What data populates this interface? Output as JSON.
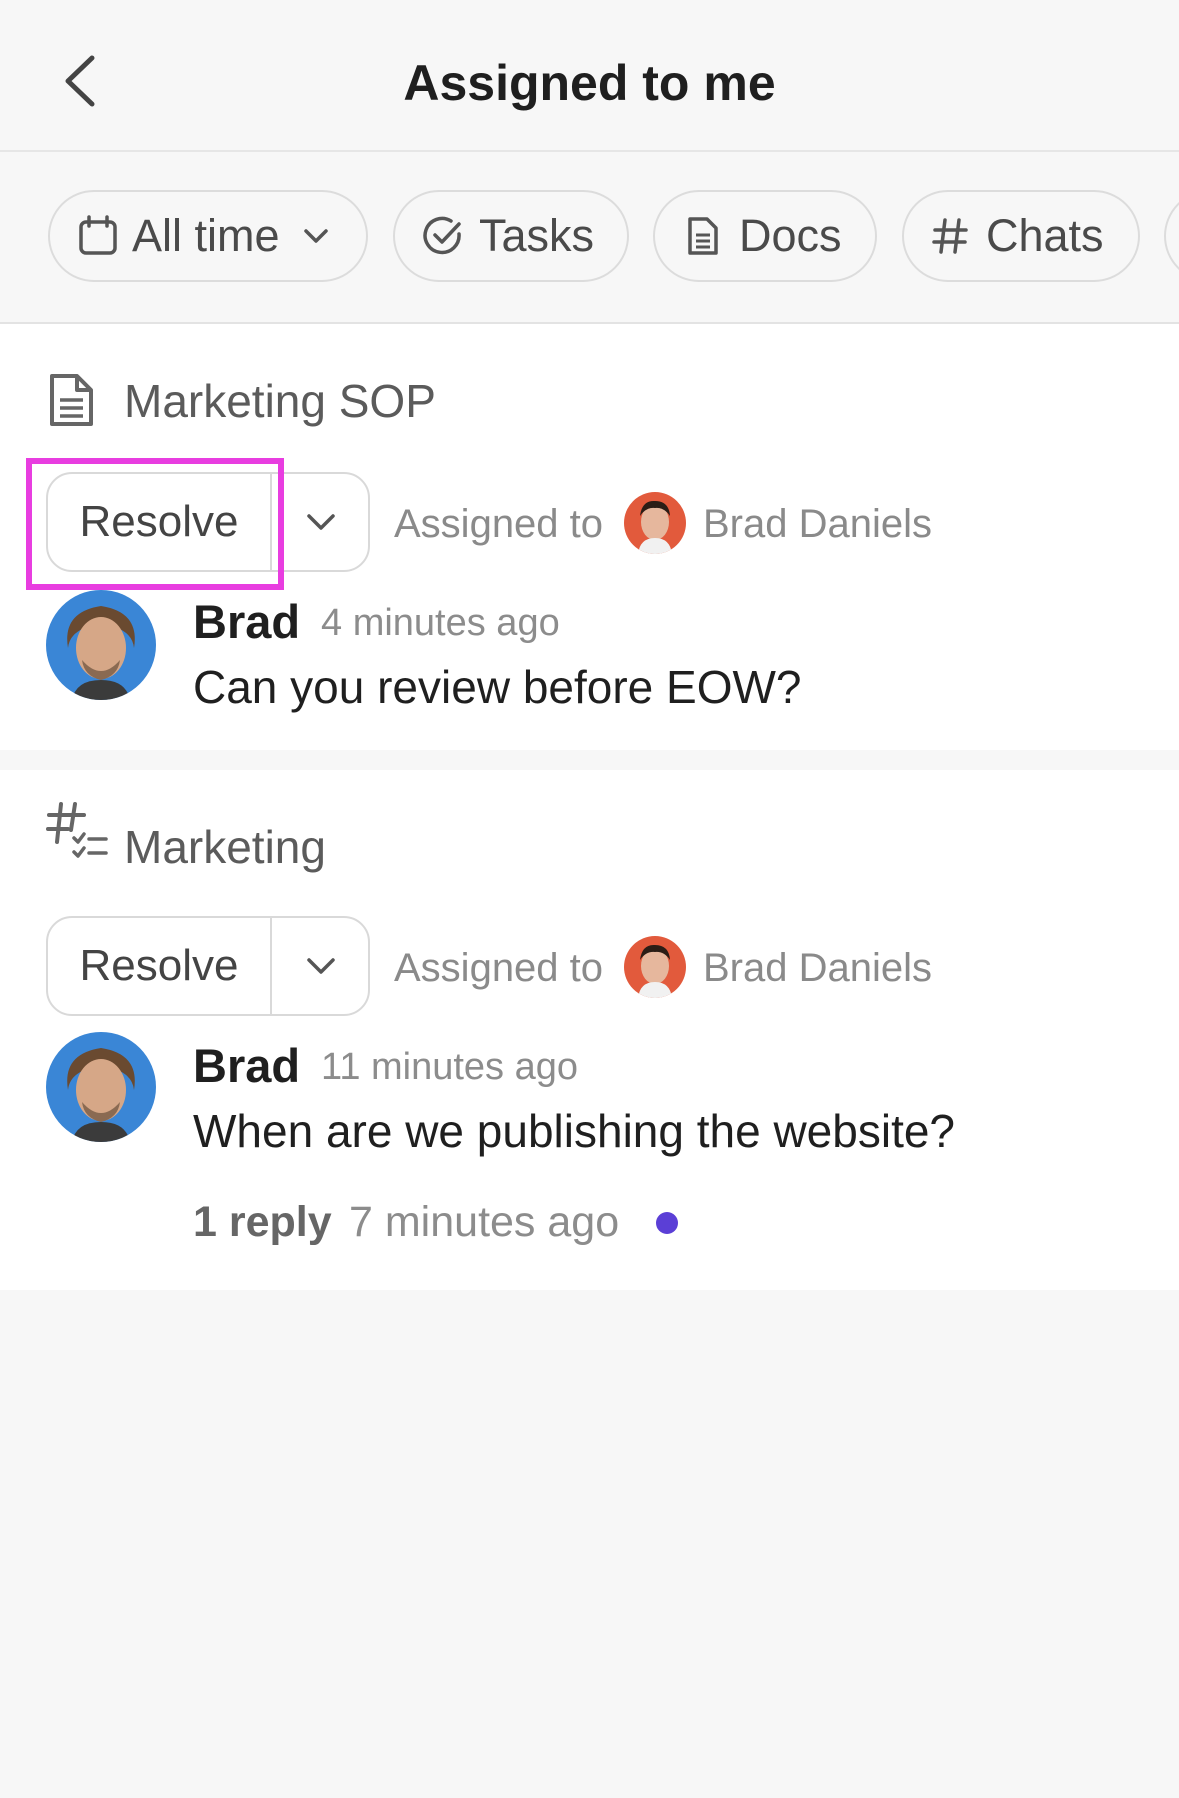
{
  "header": {
    "title": "Assigned to me",
    "back_icon": "chevron-left-icon"
  },
  "filters": [
    {
      "label": "All time",
      "icon": "calendar-icon",
      "has_dropdown": true
    },
    {
      "label": "Tasks",
      "icon": "check-circle-icon"
    },
    {
      "label": "Docs",
      "icon": "document-icon"
    },
    {
      "label": "Chats",
      "icon": "hash-icon"
    }
  ],
  "items": [
    {
      "location": "Marketing SOP",
      "location_icon": "document-icon",
      "resolve_label": "Resolve",
      "assigned_to_label": "Assigned to",
      "assignee": "Brad Daniels",
      "author": "Brad",
      "time": "4 minutes ago",
      "message": "Can you review before EOW?"
    },
    {
      "location": "Marketing",
      "location_icon": "channel-tasks-icon",
      "resolve_label": "Resolve",
      "assigned_to_label": "Assigned to",
      "assignee": "Brad Daniels",
      "author": "Brad",
      "time": "11 minutes ago",
      "message": "When are we publishing the website?",
      "reply_count": "1 reply",
      "reply_time": "7 minutes ago"
    }
  ],
  "colors": {
    "unread_dot": "#5b3fd6",
    "highlight": "#e83de0",
    "avatar_bg_author": "#3a86d6",
    "avatar_bg_assignee": "#e25a3c"
  }
}
